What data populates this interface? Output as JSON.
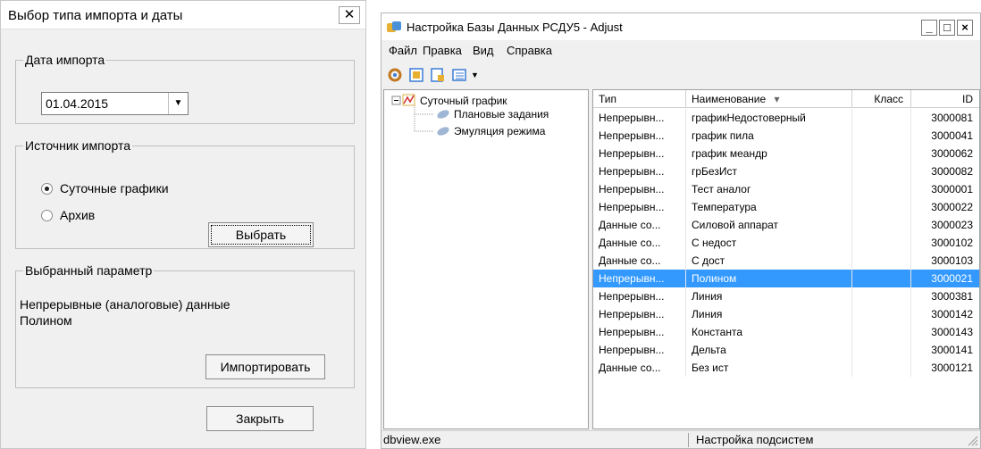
{
  "dialog": {
    "title": "Выбор типа импорта и даты",
    "date_group_label": "Дата импорта",
    "date_value": "01.04.2015",
    "source_group_label": "Источник импорта",
    "radio_daily_label": "Суточные графики",
    "radio_daily_selected": true,
    "radio_archive_label": "Архив",
    "radio_archive_selected": false,
    "select_button_label": "Выбрать",
    "selected_group_label": "Выбранный параметр",
    "selected_param_line1": "Непрерывные (аналоговые) данные",
    "selected_param_line2": "Полином",
    "import_button_label": "Импортировать",
    "close_button_label": "Закрыть",
    "close_icon": "close-icon"
  },
  "db_window": {
    "title": "Настройка Базы Данных РСДУ5 - Adjust",
    "min_label": "_",
    "max_label": "□",
    "close_label": "×",
    "menu": [
      "Файл",
      "Правка",
      "Вид",
      "Справка"
    ],
    "toolbar_icons": [
      "refresh-icon",
      "grid-icon",
      "properties-icon",
      "list-view-icon"
    ],
    "tree": {
      "root": "Суточный график",
      "children": [
        "Плановые задания",
        "Эмуляция режима"
      ]
    },
    "columns": [
      "Тип",
      "Наименование",
      "Класс",
      "ID"
    ],
    "sort_indicator": "▾",
    "rows": [
      {
        "type": "Непрерывн...",
        "name": "графикНедостоверный",
        "cls": "",
        "id": "3000081"
      },
      {
        "type": "Непрерывн...",
        "name": "график пила",
        "cls": "",
        "id": "3000041"
      },
      {
        "type": "Непрерывн...",
        "name": "график меандр",
        "cls": "",
        "id": "3000062"
      },
      {
        "type": "Непрерывн...",
        "name": "грБезИст",
        "cls": "",
        "id": "3000082"
      },
      {
        "type": "Непрерывн...",
        "name": "Тест аналог",
        "cls": "",
        "id": "3000001"
      },
      {
        "type": "Непрерывн...",
        "name": "Температура",
        "cls": "",
        "id": "3000022"
      },
      {
        "type": "Данные со...",
        "name": "Силовой аппарат",
        "cls": "",
        "id": "3000023"
      },
      {
        "type": "Данные со...",
        "name": "С недост",
        "cls": "",
        "id": "3000102"
      },
      {
        "type": "Данные со...",
        "name": "С дост",
        "cls": "",
        "id": "3000103"
      },
      {
        "type": "Непрерывн...",
        "name": "Полином",
        "cls": "",
        "id": "3000021"
      },
      {
        "type": "Непрерывн...",
        "name": "Линия",
        "cls": "",
        "id": "3000381"
      },
      {
        "type": "Непрерывн...",
        "name": "Линия",
        "cls": "",
        "id": "3000142"
      },
      {
        "type": "Непрерывн...",
        "name": "Константа",
        "cls": "",
        "id": "3000143"
      },
      {
        "type": "Непрерывн...",
        "name": "Дельта",
        "cls": "",
        "id": "3000141"
      },
      {
        "type": "Данные со...",
        "name": "Без ист",
        "cls": "",
        "id": "3000121"
      }
    ],
    "selected_row_index": 9,
    "status_left": "dbview.exe",
    "status_right": "Настройка подсистем",
    "selection_color": "#3399ff"
  }
}
